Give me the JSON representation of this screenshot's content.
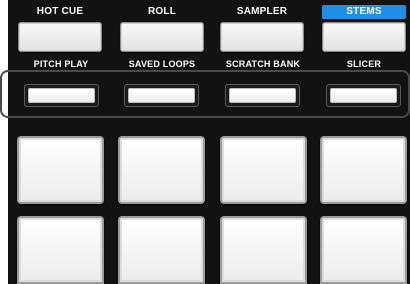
{
  "modes": {
    "hot_cue": "HOT CUE",
    "roll": "ROLL",
    "sampler": "SAMPLER",
    "stems": "STEMS",
    "active": "STEMS",
    "active_color": "#1f8ee6"
  },
  "sub_modes": {
    "pitch_play": "PITCH PLAY",
    "saved_loops": "SAVED LOOPS",
    "scratch_bank": "SCRATCH BANK",
    "slicer": "SLICER"
  },
  "pads": {
    "rows": 2,
    "columns": 4,
    "color": "#f4f4f4"
  }
}
